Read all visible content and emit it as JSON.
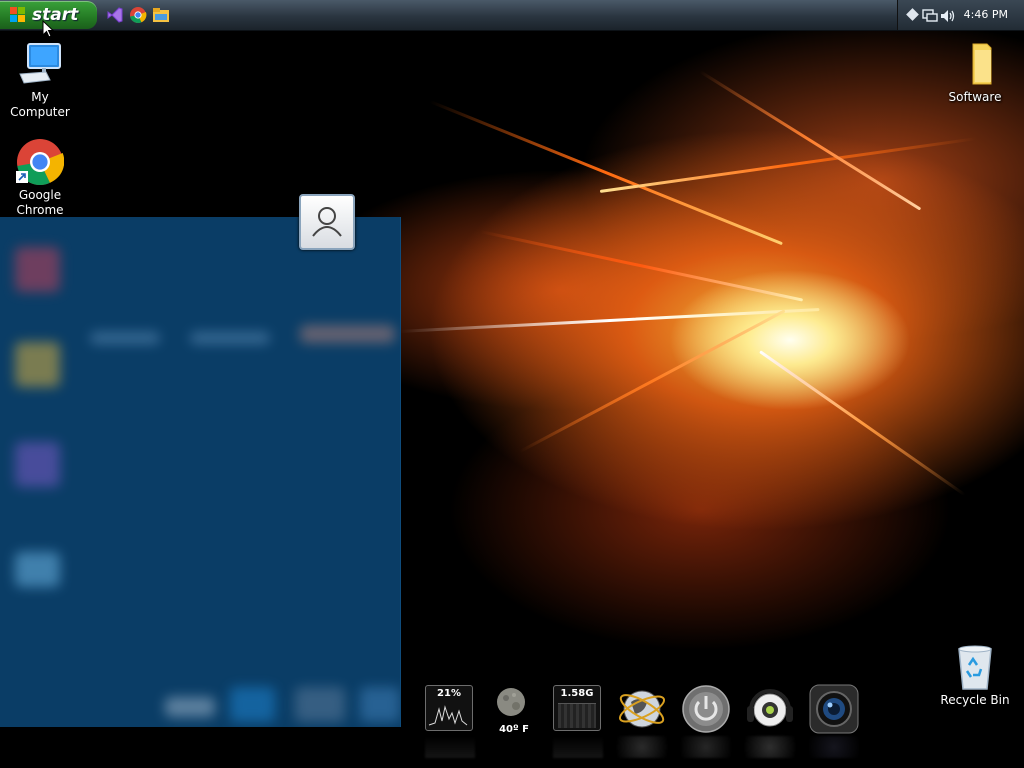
{
  "taskbar": {
    "start_label": "start",
    "quick_launch": [
      "visual-studio-icon",
      "chrome-icon",
      "file-explorer-icon"
    ],
    "tray_icons": [
      "network-diamond-icon",
      "network-monitor-icon",
      "volume-icon"
    ],
    "clock": "4:46 PM"
  },
  "desktop": {
    "icons": [
      {
        "label": "My Computer"
      },
      {
        "label": "Google Chrome"
      },
      {
        "label": "Software"
      },
      {
        "label": "Recycle Bin"
      }
    ]
  },
  "start_menu": {
    "user_icon": "user-icon"
  },
  "dock": {
    "cpu_meter": "21%",
    "weather_temp": "40º F",
    "memory_meter": "1.58G",
    "icons": [
      "cpu-meter-icon",
      "weather-moon-icon",
      "memory-meter-icon",
      "globe-icon",
      "power-icon",
      "headphones-icon",
      "camera-lens-icon"
    ]
  },
  "colors": {
    "start_green": "#247a24",
    "taskbar": "#2a3540",
    "start_menu_bg": "#0a3d66"
  }
}
